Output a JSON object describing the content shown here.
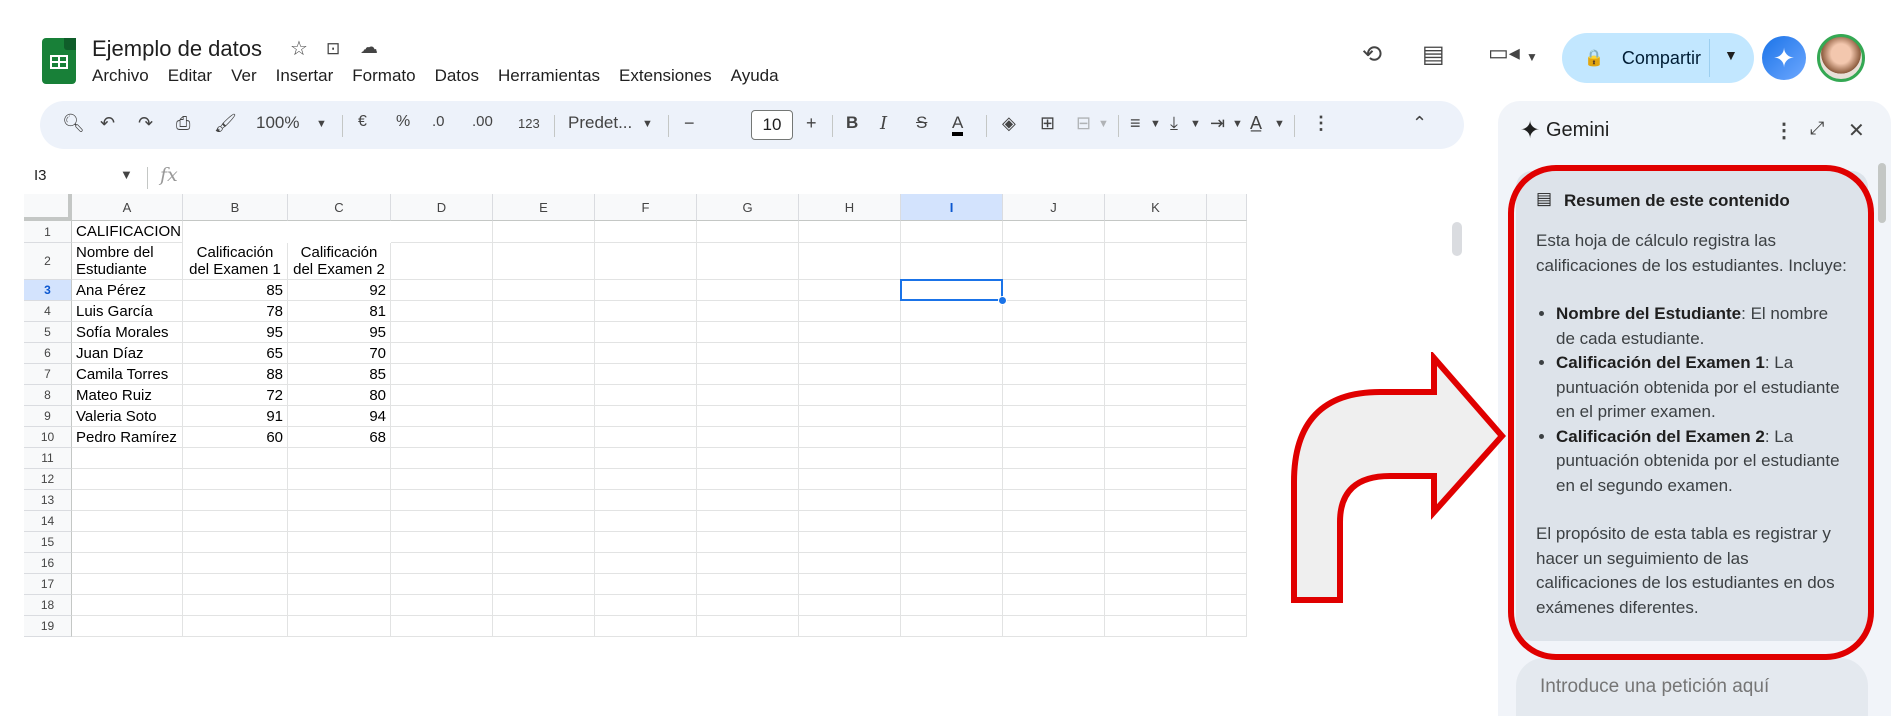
{
  "header": {
    "doc_title": "Ejemplo de datos",
    "menu": [
      "Archivo",
      "Editar",
      "Ver",
      "Insertar",
      "Formato",
      "Datos",
      "Herramientas",
      "Extensiones",
      "Ayuda"
    ],
    "share_label": "Compartir",
    "icons": [
      "star-icon",
      "move-folder-icon",
      "cloud-status-icon",
      "history-icon",
      "comments-icon",
      "meet-icon",
      "gemini-icon",
      "avatar"
    ]
  },
  "toolbar": {
    "zoom": "100%",
    "currency": "€",
    "percent": "%",
    "dec_decrease": ".0",
    "dec_increase": ".00",
    "number_format": "123",
    "font": "Predet...",
    "font_size": "10",
    "bold": "B",
    "italic": "I",
    "strike": "S",
    "text_color": "A"
  },
  "formula_bar": {
    "name_box": "I3",
    "fx": "fx"
  },
  "sheet": {
    "columns": [
      "A",
      "B",
      "C",
      "D",
      "E",
      "F",
      "G",
      "H",
      "I",
      "J",
      "K"
    ],
    "selected_column": "I",
    "selected_row": "3",
    "rows": [
      "1",
      "2",
      "3",
      "4",
      "5",
      "6",
      "7",
      "8",
      "9",
      "10",
      "11",
      "12",
      "13",
      "14",
      "15",
      "16",
      "17",
      "18",
      "19"
    ],
    "title": "CALIFICACIONES",
    "headers": [
      "Nombre del Estudiante",
      "Calificación del Examen 1",
      "Calificación del Examen 2"
    ],
    "students": [
      {
        "name": "Ana Pérez",
        "e1": "85",
        "e2": "92"
      },
      {
        "name": "Luis García",
        "e1": "78",
        "e2": "81"
      },
      {
        "name": "Sofía Morales",
        "e1": "95",
        "e2": "95"
      },
      {
        "name": "Juan Díaz",
        "e1": "65",
        "e2": "70"
      },
      {
        "name": "Camila Torres",
        "e1": "88",
        "e2": "85"
      },
      {
        "name": "Mateo Ruiz",
        "e1": "72",
        "e2": "80"
      },
      {
        "name": "Valeria Soto",
        "e1": "91",
        "e2": "94"
      },
      {
        "name": "Pedro Ramírez",
        "e1": "60",
        "e2": "68"
      }
    ]
  },
  "gemini": {
    "title": "Gemini",
    "card_title": "Resumen de este contenido",
    "intro": "Esta hoja de cálculo registra las calificaciones de los estudiantes. Incluye:",
    "bullets": [
      {
        "term": "Nombre del Estudiante",
        "desc": ": El nombre de cada estudiante."
      },
      {
        "term": "Calificación del Examen 1",
        "desc": ": La puntuación obtenida por el estudiante en el primer examen."
      },
      {
        "term": "Calificación del Examen 2",
        "desc": ": La puntuación obtenida por el estudiante en el segundo examen."
      }
    ],
    "closing": "El propósito de esta tabla es registrar y hacer un seguimiento de las calificaciones de los estudiantes en dos exámenes diferentes.",
    "prompt_placeholder": "Introduce una petición aquí"
  },
  "colors": {
    "accent": "#1a73e8",
    "share_bg": "#c2e7ff",
    "annotation": "#e00000",
    "sheets_green": "#188038"
  }
}
